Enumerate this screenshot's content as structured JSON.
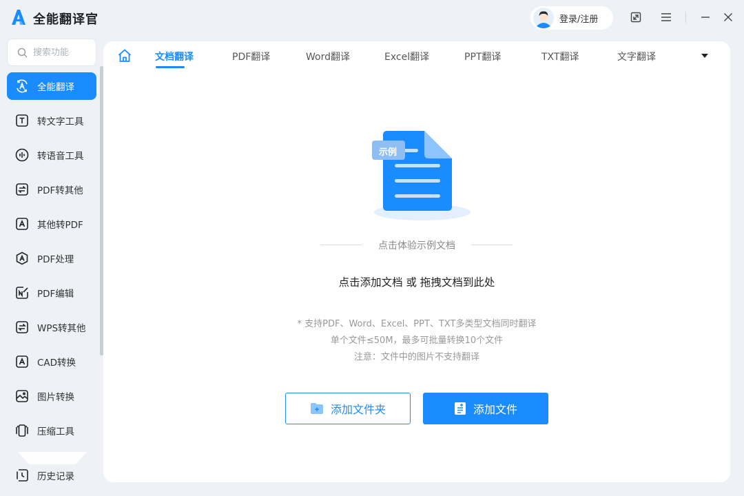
{
  "app": {
    "title": "全能翻译官",
    "login_label": "登录/注册"
  },
  "sidebar": {
    "search_placeholder": "搜索功能",
    "items": [
      {
        "label": "全能翻译",
        "icon": "translate-icon",
        "active": true
      },
      {
        "label": "转文字工具",
        "icon": "text-t-icon"
      },
      {
        "label": "转语音工具",
        "icon": "audio-wave-icon"
      },
      {
        "label": "PDF转其他",
        "icon": "pdf-convert-icon"
      },
      {
        "label": "其他转PDF",
        "icon": "to-pdf-icon"
      },
      {
        "label": "PDF处理",
        "icon": "pdf-process-icon"
      },
      {
        "label": "PDF编辑",
        "icon": "pdf-edit-icon"
      },
      {
        "label": "WPS转其他",
        "icon": "wps-convert-icon"
      },
      {
        "label": "CAD转换",
        "icon": "cad-icon"
      },
      {
        "label": "图片转换",
        "icon": "image-icon"
      },
      {
        "label": "压缩工具",
        "icon": "compress-icon"
      }
    ],
    "history_label": "历史记录"
  },
  "tabs": [
    {
      "label": "文档翻译",
      "active": true
    },
    {
      "label": "PDF翻译"
    },
    {
      "label": "Word翻译"
    },
    {
      "label": "Excel翻译"
    },
    {
      "label": "PPT翻译"
    },
    {
      "label": "TXT翻译"
    },
    {
      "label": "文字翻译"
    }
  ],
  "main": {
    "sample_badge": "示例",
    "sample_link": "点击体验示例文档",
    "drop_text": "点击添加文档 或 拖拽文档到此处",
    "notes": [
      "* 支持PDF、Word、Excel、PPT、TXT多类型文档同时翻译",
      "单个文件≤50M，最多可批量转换10个文件",
      "注意：文件中的图片不支持翻译"
    ],
    "add_folder_label": "添加文件夹",
    "add_file_label": "添加文件"
  },
  "colors": {
    "accent": "#1a8cff",
    "background": "#eef1f6"
  }
}
